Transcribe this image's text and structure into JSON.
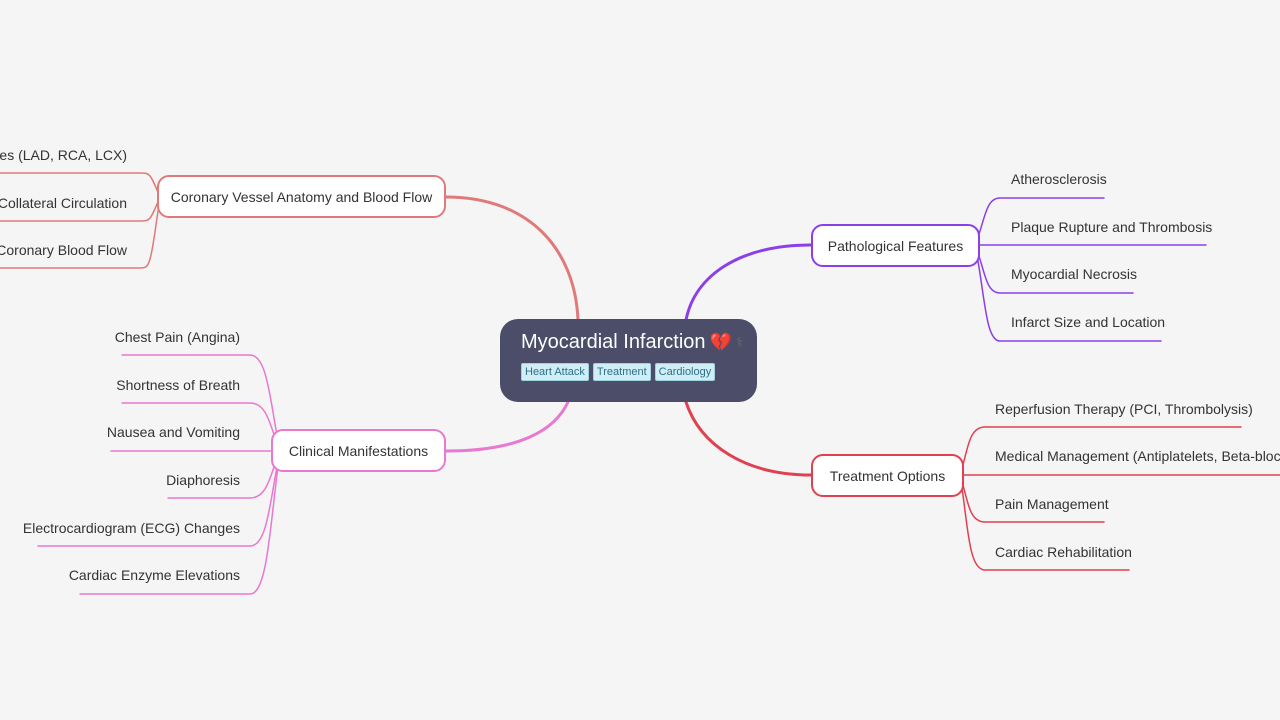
{
  "center": {
    "title": "Myocardial Infarction",
    "emoji_icons": [
      "broken-heart-icon",
      "medical-staff-icon"
    ],
    "heart_glyph": "💔",
    "staff_glyph": "⚕",
    "tags": [
      "Heart Attack",
      "Treatment",
      "Cardiology"
    ]
  },
  "branches": [
    {
      "id": "coronary",
      "label": "Coronary Vessel Anatomy and Blood Flow",
      "color": "#e07a7a",
      "side": "left",
      "children": [
        "Coronary Arteries (LAD, RCA, LCX)",
        "Collateral Circulation",
        "Coronary Blood Flow"
      ],
      "visible_children": [
        "teries (LAD, RCA, LCX)",
        "Collateral Circulation",
        "Coronary Blood Flow"
      ]
    },
    {
      "id": "clinical",
      "label": "Clinical Manifestations",
      "color": "#e878d0",
      "side": "left",
      "children": [
        "Chest Pain (Angina)",
        "Shortness of Breath",
        "Nausea and Vomiting",
        "Diaphoresis",
        "Electrocardiogram (ECG) Changes",
        "Cardiac Enzyme Elevations"
      ]
    },
    {
      "id": "pathological",
      "label": "Pathological Features",
      "color": "#8b3fe8",
      "side": "right",
      "children": [
        "Atherosclerosis",
        "Plaque Rupture and Thrombosis",
        "Myocardial Necrosis",
        "Infarct Size and Location"
      ]
    },
    {
      "id": "treatment",
      "label": "Treatment Options",
      "color": "#e0404f",
      "side": "right",
      "children": [
        "Reperfusion Therapy (PCI, Thrombolysis)",
        "Medical Management (Antiplatelets, Beta-blockers)",
        "Pain Management",
        "Cardiac Rehabilitation"
      ]
    }
  ]
}
